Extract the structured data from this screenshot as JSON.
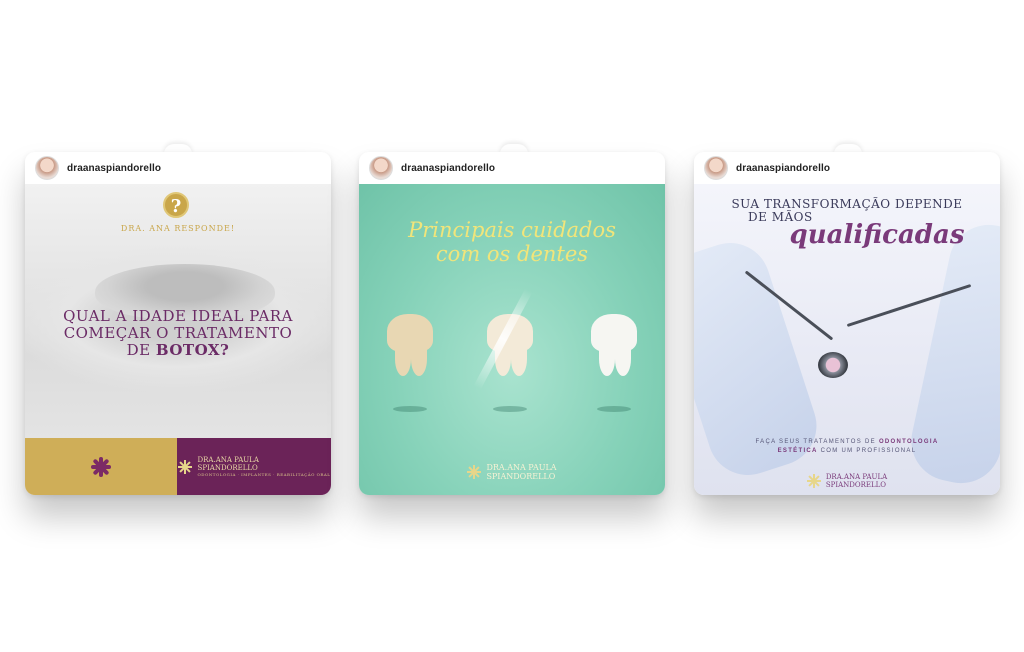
{
  "posts": [
    {
      "username": "draanaspiandorello",
      "badge": "?",
      "kicker": "DRA. ANA RESPONDE!",
      "headline_lines": [
        "QUAL A IDADE IDEAL PARA",
        "COMEÇAR O TRATAMENTO",
        "DE "
      ],
      "headline_bold": "BOTOX?",
      "brand_name_1": "DRA.ANA PAULA",
      "brand_name_2": "SPIANDORELLO",
      "brand_sub": "ODONTOLOGIA · IMPLANTES · REABILITAÇÃO ORAL",
      "colors": {
        "gold": "#cfae58",
        "purple": "#6b2358"
      }
    },
    {
      "username": "draanaspiandorello",
      "title_line1": "Principais cuidados",
      "title_line2": "com os dentes",
      "brand_name_1": "DRA.ANA PAULA",
      "brand_name_2": "SPIANDORELLO",
      "colors": {
        "mint": "#86d2b9",
        "script": "#f1e57a"
      }
    },
    {
      "username": "draanaspiandorello",
      "title_line1": "SUA TRANSFORMAÇÃO DEPENDE",
      "title_line2": "DE MÃOS",
      "script_word": "qualificadas",
      "tagline_pre": "FAÇA SEUS TRATAMENTOS DE ",
      "tagline_bold1": "ODONTOLOGIA",
      "tagline_bold2": "ESTÉTICA",
      "tagline_post": " COM UM PROFISSIONAL",
      "brand_name_1": "DRA.ANA PAULA",
      "brand_name_2": "SPIANDORELLO",
      "colors": {
        "accent": "#7a3a7a"
      }
    }
  ]
}
